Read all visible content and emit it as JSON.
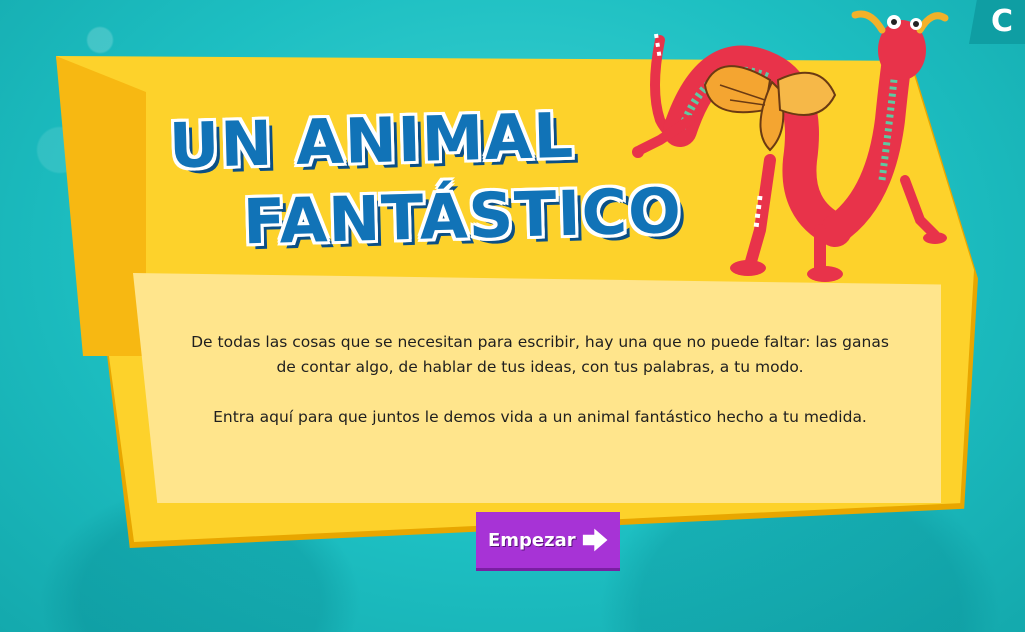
{
  "title": {
    "line1": "UN ANIMAL",
    "line2": "FANTÁSTICO"
  },
  "intro": {
    "paragraph1": "De todas las cosas que se necesitan para escribir, hay una que no puede faltar: las ganas de contar algo, de hablar de tus ideas, con tus palabras, a tu modo.",
    "paragraph2": "Entra aquí para que juntos le demos vida a un animal fantástico hecho a tu medida."
  },
  "start_button": {
    "label": "Empezar",
    "icon": "arrow-right-icon"
  },
  "corner_badge": {
    "letter": "C"
  },
  "colors": {
    "background": "#1dbfc2",
    "board": "#fdd22b",
    "panel": "#ffe58c",
    "title": "#1173b7",
    "button": "#a733d6"
  },
  "illustration": {
    "icon": "alebrije-creature-icon"
  }
}
